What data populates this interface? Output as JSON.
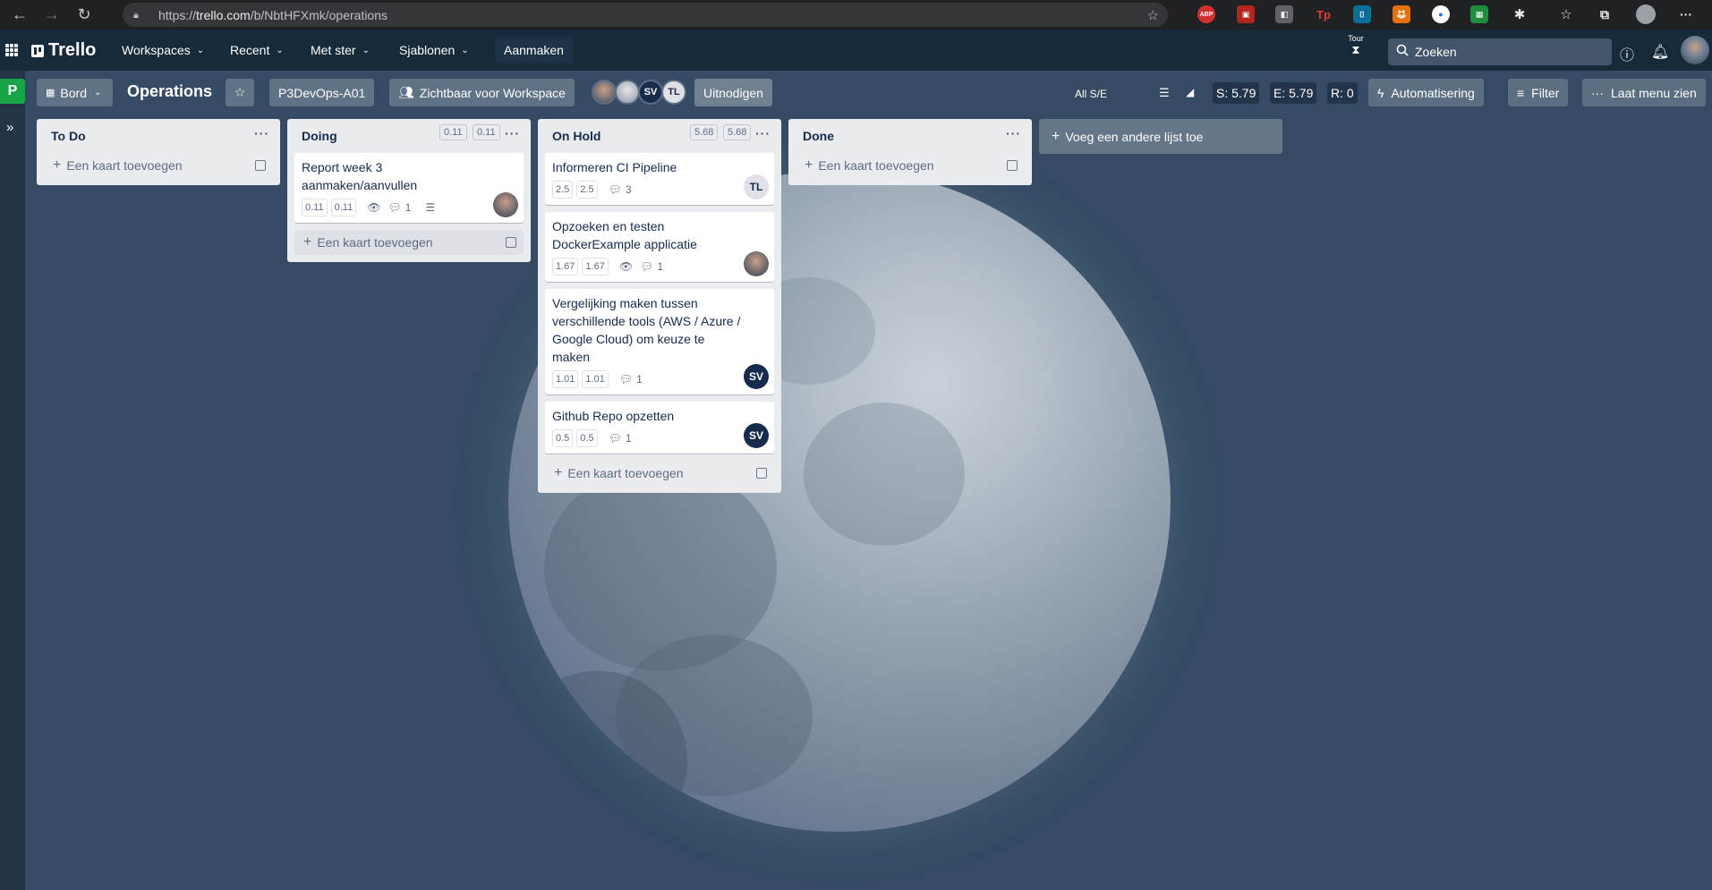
{
  "browser": {
    "url_prefix": "https://",
    "url_host": "trello.com",
    "url_path": "/b/NbtHFXmk/operations"
  },
  "header": {
    "logo_text": "Trello",
    "nav": [
      "Workspaces",
      "Recent",
      "Met ster",
      "Sjablonen"
    ],
    "create_label": "Aanmaken",
    "tour_label": "Tour",
    "search_placeholder": "Zoeken"
  },
  "board": {
    "workspace_initial": "P",
    "view_label": "Bord",
    "title": "Operations",
    "workspace_name": "P3DevOps-A01",
    "visibility_label": "Zichtbaar voor Workspace",
    "members": [
      "SV",
      "TL"
    ],
    "invite_label": "Uitnodigen",
    "all_se_label": "All S/E",
    "stats": {
      "s": "S: 5.79",
      "e": "E: 5.79",
      "r": "R: 0"
    },
    "automation_label": "Automatisering",
    "filter_label": "Filter",
    "menu_label": "Laat menu zien"
  },
  "add_card_label": "Een kaart toevoegen",
  "add_list_label": "Voeg een andere lijst toe",
  "lists": [
    {
      "title": "To Do",
      "badges": []
    },
    {
      "title": "Doing",
      "badges": [
        "0.11",
        "0.11"
      ],
      "cards": [
        {
          "title": "Report week 3 aanmaken/aanvullen",
          "points": [
            "0.11",
            "0.11"
          ],
          "comments": "1",
          "member": "photo"
        }
      ]
    },
    {
      "title": "On Hold",
      "badges": [
        "5.68",
        "5.68"
      ],
      "cards": [
        {
          "title": "Informeren CI Pipeline",
          "points": [
            "2.5",
            "2.5"
          ],
          "comments": "3",
          "member": "TL"
        },
        {
          "title": "Opzoeken en testen DockerExample applicatie",
          "points": [
            "1.67",
            "1.67"
          ],
          "comments": "1",
          "member": "photo"
        },
        {
          "title": "Vergelijking maken tussen verschillende tools (AWS / Azure / Google Cloud) om keuze te maken",
          "points": [
            "1.01",
            "1.01"
          ],
          "comments": "1",
          "member": "SV"
        },
        {
          "title": "Github Repo opzetten",
          "points": [
            "0.5",
            "0.5"
          ],
          "comments": "1",
          "member": "SV"
        }
      ]
    },
    {
      "title": "Done",
      "badges": []
    }
  ],
  "colors": {
    "member_sv": "#172b4d",
    "member_tl": "#dfe1e6",
    "workspace_green": "#19a547"
  }
}
